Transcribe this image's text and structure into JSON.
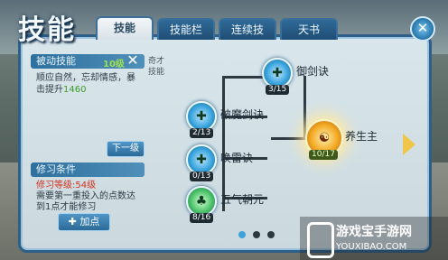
{
  "title": "技能",
  "tabs": [
    {
      "label": "技能",
      "active": true
    },
    {
      "label": "技能栏",
      "active": false
    },
    {
      "label": "连续技",
      "active": false
    },
    {
      "label": "天书",
      "active": false
    }
  ],
  "left_panel": {
    "header": "被动技能",
    "level": "10级",
    "description_lines": [
      "顺应自然，忘却情感，暴",
      "击提升"
    ],
    "description_value": "1460",
    "next_button": "下一级",
    "requirement_title": "修习条件",
    "requirement_level": "修习等级:54级",
    "requirement_lines": [
      "需要第一重投入的点数达",
      "到1点才能修习"
    ],
    "add_button": "加点"
  },
  "tree": {
    "side_text_lines": [
      "奇才",
      "技能"
    ],
    "skills": [
      {
        "name": "御剑诀",
        "count": "3/15",
        "glyph": "✚",
        "style": "blue"
      },
      {
        "name": "破魔剑诀",
        "count": "2/13",
        "glyph": "✚",
        "style": "blue"
      },
      {
        "name": "唤雷诀",
        "count": "0/13",
        "glyph": "✚",
        "style": "blue"
      },
      {
        "name": "五气朝元",
        "count": "8/16",
        "glyph": "♣",
        "style": "green"
      },
      {
        "name": "养生主",
        "count": "10/17",
        "glyph": "☯",
        "style": "gold"
      }
    ],
    "page_dots": [
      true,
      false,
      false
    ]
  },
  "watermark": {
    "text": "游戏宝手游网",
    "url": "YOUXIBAO.COM"
  },
  "colors": {
    "frame": "#2e5f88",
    "accent_blue": "#3aa5de",
    "accent_gold": "#f3a923",
    "value_green": "#3a9b2a",
    "warning_red": "#d4321e"
  }
}
